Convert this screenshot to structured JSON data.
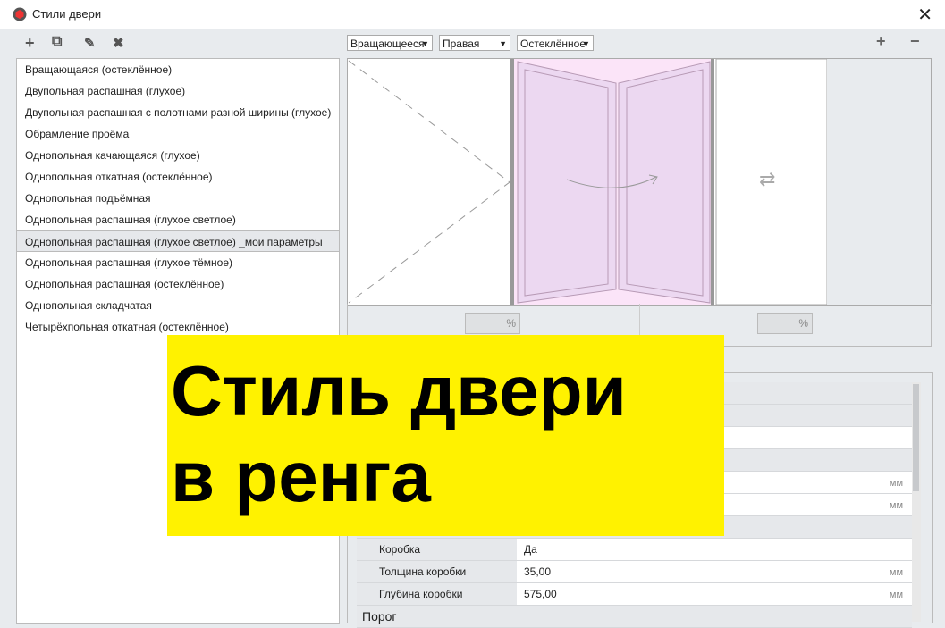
{
  "window": {
    "title": "Стили двери",
    "close": "✕"
  },
  "toolbar": {
    "add": "+",
    "copy": "⧉",
    "edit": "✎",
    "delete": "✖"
  },
  "styles": [
    "Вращающаяся (остеклённое)",
    "Двупольная распашная (глухое)",
    "Двупольная распашная с полотнами разной ширины (глухое)",
    "Обрамление проёма",
    "Однопольная качающаяся (глухое)",
    "Однопольная откатная (остеклённое)",
    "Однопольная подъёмная",
    "Однопольная распашная (глухое светлое)",
    "Однопольная распашная (глухое светлое) _мои параметры",
    "Однопольная распашная (глухое тёмное)",
    "Однопольная распашная (остеклённое)",
    "Однопольная складчатая",
    "Четырёхпольная откатная (остеклённое)"
  ],
  "selected_index": 8,
  "dropdowns": {
    "type": "Вращающееся",
    "side": "Правая",
    "fill": "Остеклённое"
  },
  "preview_controls": {
    "add": "+",
    "remove": "−",
    "swap": "⇄",
    "pct_left": "%",
    "pct_right": "%"
  },
  "properties": {
    "unit": "мм",
    "korobka_label": "Коробка",
    "korobka_value": "Да",
    "thickness_label": "Толщина коробки",
    "thickness_value": "35,00",
    "depth_label": "Глубина коробки",
    "depth_value": "575,00",
    "porog_label": "Порог"
  },
  "banner": {
    "line1": "Стиль двери",
    "line2": "в ренга"
  }
}
